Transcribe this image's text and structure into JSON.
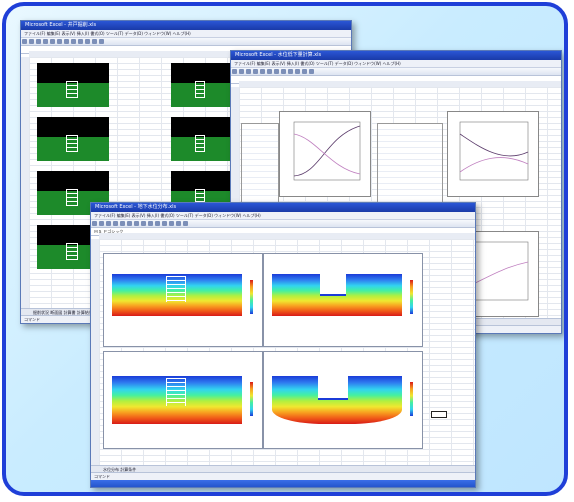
{
  "windows": {
    "back": {
      "title": "Microsoft Excel - 井戸掘削.xls",
      "menu": "ファイル(F)  編集(E)  表示(V)  挿入(I)  書式(O)  ツール(T)  データ(D)  ウィンドウ(W)  ヘルプ(H)",
      "zoom": "75%",
      "help": "質問を入力してください",
      "sheet_tabs": "掘削状況  断面図  計算書  計算結果",
      "status": "コマンド"
    },
    "middle": {
      "title": "Microsoft Excel - 水位低下量計算.xls",
      "menu": "ファイル(F)  編集(E)  表示(V)  挿入(I)  書式(O)  ツール(T)  データ(D)  ウィンドウ(W)  ヘルプ(H)",
      "zoom": "100%",
      "help": "質問を入力してください",
      "sheet_tabs": "計算結果  グラフ",
      "status": "コマンド"
    },
    "front": {
      "title": "Microsoft Excel - 地下水位分布.xls",
      "menu": "ファイル(F)  編集(E)  表示(V)  挿入(I)  書式(O)  ツール(T)  データ(D)  ウィンドウ(W)  ヘルプ(H)",
      "zoom": "100%",
      "help": "質問を入力してください",
      "font_box": "ＭＳ Ｐゴシック",
      "sheet_tabs": "水位分布  計算条件",
      "status": "コマンド"
    }
  },
  "icons": [
    "toolbar-button-icon"
  ],
  "colors": {
    "frame": "#1f3fd8",
    "titlebar": "#2455cc",
    "ground": "#1d8a2a"
  }
}
